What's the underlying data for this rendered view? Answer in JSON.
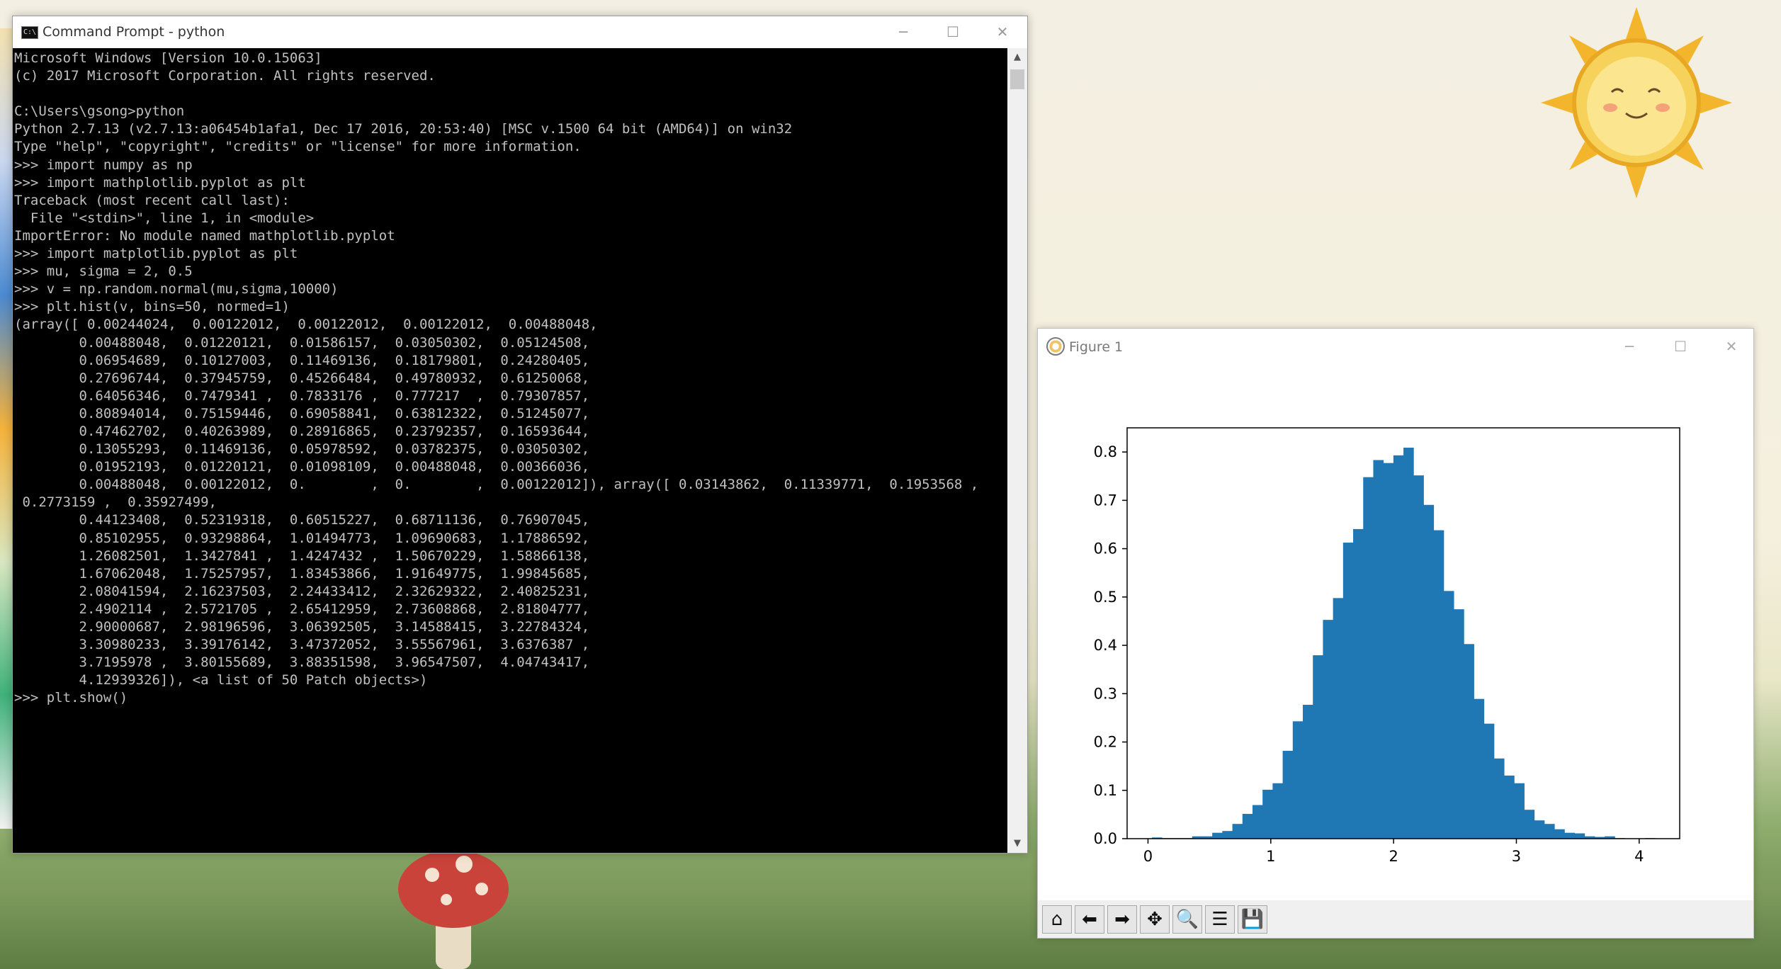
{
  "cmd_window": {
    "title": "Command Prompt - python",
    "lines": [
      "Microsoft Windows [Version 10.0.15063]",
      "(c) 2017 Microsoft Corporation. All rights reserved.",
      "",
      "C:\\Users\\gsong>python",
      "Python 2.7.13 (v2.7.13:a06454b1afa1, Dec 17 2016, 20:53:40) [MSC v.1500 64 bit (AMD64)] on win32",
      "Type \"help\", \"copyright\", \"credits\" or \"license\" for more information.",
      ">>> import numpy as np",
      ">>> import mathplotlib.pyplot as plt",
      "Traceback (most recent call last):",
      "  File \"<stdin>\", line 1, in <module>",
      "ImportError: No module named mathplotlib.pyplot",
      ">>> import matplotlib.pyplot as plt",
      ">>> mu, sigma = 2, 0.5",
      ">>> v = np.random.normal(mu,sigma,10000)",
      ">>> plt.hist(v, bins=50, normed=1)",
      "(array([ 0.00244024,  0.00122012,  0.00122012,  0.00122012,  0.00488048,",
      "        0.00488048,  0.01220121,  0.01586157,  0.03050302,  0.05124508,",
      "        0.06954689,  0.10127003,  0.11469136,  0.18179801,  0.24280405,",
      "        0.27696744,  0.37945759,  0.45266484,  0.49780932,  0.61250068,",
      "        0.64056346,  0.7479341 ,  0.7833176 ,  0.777217  ,  0.79307857,",
      "        0.80894014,  0.75159446,  0.69058841,  0.63812322,  0.51245077,",
      "        0.47462702,  0.40263989,  0.28916865,  0.23792357,  0.16593644,",
      "        0.13055293,  0.11469136,  0.05978592,  0.03782375,  0.03050302,",
      "        0.01952193,  0.01220121,  0.01098109,  0.00488048,  0.00366036,",
      "        0.00488048,  0.00122012,  0.        ,  0.        ,  0.00122012]), array([ 0.03143862,  0.11339771,  0.1953568 ,",
      " 0.2773159 ,  0.35927499,",
      "        0.44123408,  0.52319318,  0.60515227,  0.68711136,  0.76907045,",
      "        0.85102955,  0.93298864,  1.01494773,  1.09690683,  1.17886592,",
      "        1.26082501,  1.3427841 ,  1.4247432 ,  1.50670229,  1.58866138,",
      "        1.67062048,  1.75257957,  1.83453866,  1.91649775,  1.99845685,",
      "        2.08041594,  2.16237503,  2.24433412,  2.32629322,  2.40825231,",
      "        2.4902114 ,  2.5721705 ,  2.65412959,  2.73608868,  2.81804777,",
      "        2.90000687,  2.98196596,  3.06392505,  3.14588415,  3.22784324,",
      "        3.30980233,  3.39176142,  3.47372052,  3.55567961,  3.6376387 ,",
      "        3.7195978 ,  3.80155689,  3.88351598,  3.96547507,  4.04743417,",
      "        4.12939326]), <a list of 50 Patch objects>)",
      ">>> plt.show()"
    ]
  },
  "figure_window": {
    "title": "Figure 1",
    "toolbar": [
      "home-icon",
      "back-icon",
      "forward-icon",
      "pan-icon",
      "zoom-icon",
      "configure-subplots-icon",
      "save-icon"
    ]
  },
  "window_controls": {
    "minimize": "─",
    "maximize": "☐",
    "close": "✕"
  },
  "colors": {
    "bar": "#1f77b4",
    "console_bg": "#000000",
    "console_fg": "#c0c0c0"
  },
  "chart_data": {
    "type": "bar",
    "title": "",
    "xlabel": "",
    "ylabel": "",
    "xlim": [
      -0.17,
      4.33
    ],
    "ylim": [
      0,
      0.85
    ],
    "xticks": [
      "0",
      "1",
      "2",
      "3",
      "4"
    ],
    "yticks": [
      "0.0",
      "0.1",
      "0.2",
      "0.3",
      "0.4",
      "0.5",
      "0.6",
      "0.7",
      "0.8"
    ],
    "bin_edges": [
      0.03143862,
      0.11339771,
      0.1953568,
      0.2773159,
      0.35927499,
      0.44123408,
      0.52319318,
      0.60515227,
      0.68711136,
      0.76907045,
      0.85102955,
      0.93298864,
      1.01494773,
      1.09690683,
      1.17886592,
      1.26082501,
      1.3427841,
      1.4247432,
      1.50670229,
      1.58866138,
      1.67062048,
      1.75257957,
      1.83453866,
      1.91649775,
      1.99845685,
      2.08041594,
      2.16237503,
      2.24433412,
      2.32629322,
      2.40825231,
      2.4902114,
      2.5721705,
      2.65412959,
      2.73608868,
      2.81804777,
      2.90000687,
      2.98196596,
      3.06392505,
      3.14588415,
      3.22784324,
      3.30980233,
      3.39176142,
      3.47372052,
      3.55567961,
      3.6376387,
      3.7195978,
      3.80155689,
      3.88351598,
      3.96547507,
      4.04743417,
      4.12939326
    ],
    "values": [
      0.00244024,
      0.00122012,
      0.00122012,
      0.00122012,
      0.00488048,
      0.00488048,
      0.01220121,
      0.01586157,
      0.03050302,
      0.05124508,
      0.06954689,
      0.10127003,
      0.11469136,
      0.18179801,
      0.24280405,
      0.27696744,
      0.37945759,
      0.45266484,
      0.49780932,
      0.61250068,
      0.64056346,
      0.7479341,
      0.7833176,
      0.777217,
      0.79307857,
      0.80894014,
      0.75159446,
      0.69058841,
      0.63812322,
      0.51245077,
      0.47462702,
      0.40263989,
      0.28916865,
      0.23792357,
      0.16593644,
      0.13055293,
      0.11469136,
      0.05978592,
      0.03782375,
      0.03050302,
      0.01952193,
      0.01220121,
      0.01098109,
      0.00488048,
      0.00366036,
      0.00488048,
      0.00122012,
      0,
      0,
      0.00122012
    ]
  }
}
